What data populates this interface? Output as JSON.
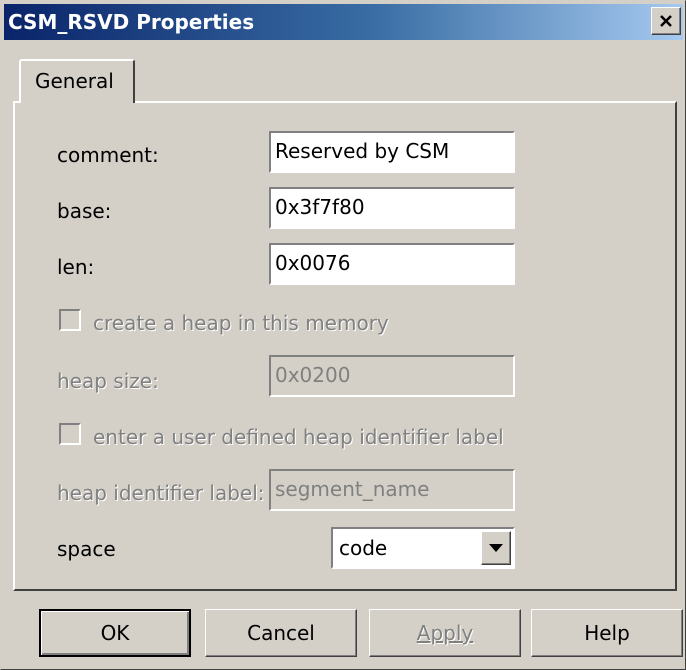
{
  "window": {
    "title": "CSM_RSVD Properties"
  },
  "tabs": [
    {
      "label": "General",
      "active": true
    }
  ],
  "form": {
    "comment": {
      "label": "comment:",
      "value": "Reserved by CSM"
    },
    "base": {
      "label": "base:",
      "value": "0x3f7f80"
    },
    "len": {
      "label": "len:",
      "value": "0x0076"
    },
    "create_heap": {
      "label": "create a heap in this memory",
      "checked": false,
      "enabled": false
    },
    "heap_size": {
      "label": "heap size:",
      "value": "0x0200",
      "enabled": false
    },
    "user_heap_label": {
      "label": "enter a user defined heap identifier label",
      "checked": false,
      "enabled": false
    },
    "heap_identifier": {
      "label": "heap identifier label:",
      "value": "segment_name",
      "enabled": false
    },
    "space": {
      "label": "space",
      "value": "code"
    }
  },
  "buttons": {
    "ok": "OK",
    "cancel": "Cancel",
    "apply": "Apply",
    "help": "Help"
  },
  "icons": {
    "close": "close-icon",
    "dropdown": "dropdown-arrow-icon"
  },
  "colors": {
    "titlebar_start": "#0a246a",
    "titlebar_end": "#a6caf0",
    "dialog_bg": "#d4d0c8",
    "disabled_text": "#808080"
  }
}
